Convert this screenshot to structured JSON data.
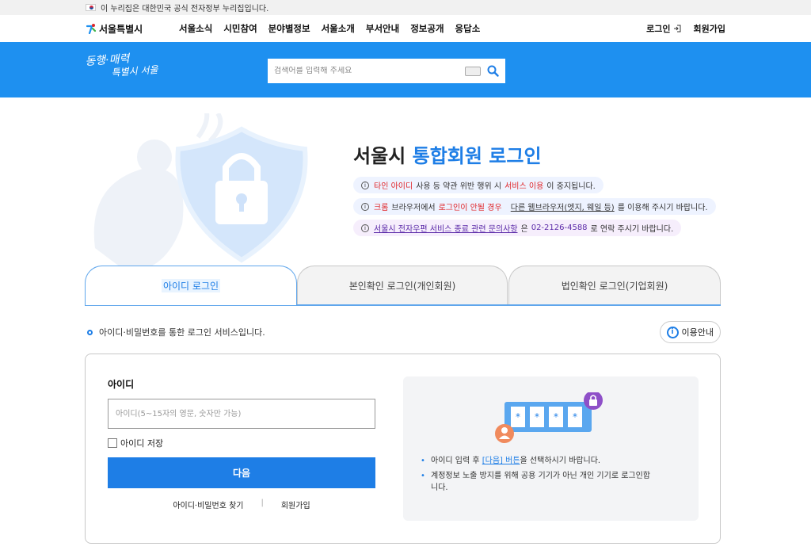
{
  "gov_strip": {
    "text": "이 누리집은 대한민국 공식 전자정부 누리집입니다."
  },
  "header": {
    "logo_text": "서울특별시",
    "menu": [
      "서울소식",
      "시민참여",
      "분야별정보",
      "서울소개",
      "부서안내",
      "정보공개",
      "응답소"
    ],
    "login": "로그인",
    "signup": "회원가입"
  },
  "banner": {
    "slogan_line1": "동행·매력",
    "slogan_line2": "특별시 서울",
    "search_placeholder": "검색어를 입력해 주세요"
  },
  "hero": {
    "title_prefix": "서울시 ",
    "title_highlight": "통합회원 로그인",
    "notices": [
      {
        "red1": "타인 아이디",
        "t1": " 사용 등 약관 위반 행위 시 ",
        "red2": "서비스 이용",
        "t2": "이 중지됩니다."
      },
      {
        "red1": "크롬",
        "t1": " 브라우저에서 ",
        "red2": "로그인이 안될 경우",
        "u": "다른 웹브라우저(엣지, 웨일 등)",
        "t2": "를 이용해 주시기 바랍니다."
      },
      {
        "link": "서울시 전자우편 서비스 종료 관련 문의사항",
        "t1": "은 ",
        "phone": "02-2126-4588",
        "t2": "로 연락 주시기 바랍니다."
      }
    ]
  },
  "tabs": [
    "아이디 로그인",
    "본인확인 로그인(개인회원)",
    "법인확인 로그인(기업회원)"
  ],
  "login": {
    "description": "아이디·비밀번호를 통한 로그인 서비스입니다.",
    "help": "이용안내",
    "id_label": "아이디",
    "id_placeholder": "아이디(5~15자의 영문, 숫자만 가능)",
    "save_id": "아이디 저장",
    "next": "다음",
    "find": "아이디·비밀번호 찾기",
    "join": "회원가입"
  },
  "info": {
    "b1_pre": "아이디 입력 후 ",
    "b1_hl": "[다음] 버튼",
    "b1_post": "을 선택하시기 바랍니다.",
    "b2": "계정정보 노출 방지를 위해 공용 기기가 아닌 개인 기기로 로그인합니다.",
    "stars": [
      "*",
      "*",
      "*",
      "*"
    ]
  },
  "colors": {
    "primary": "#1e7ee6",
    "banner": "#1e90f0",
    "warn": "#e0262a"
  }
}
